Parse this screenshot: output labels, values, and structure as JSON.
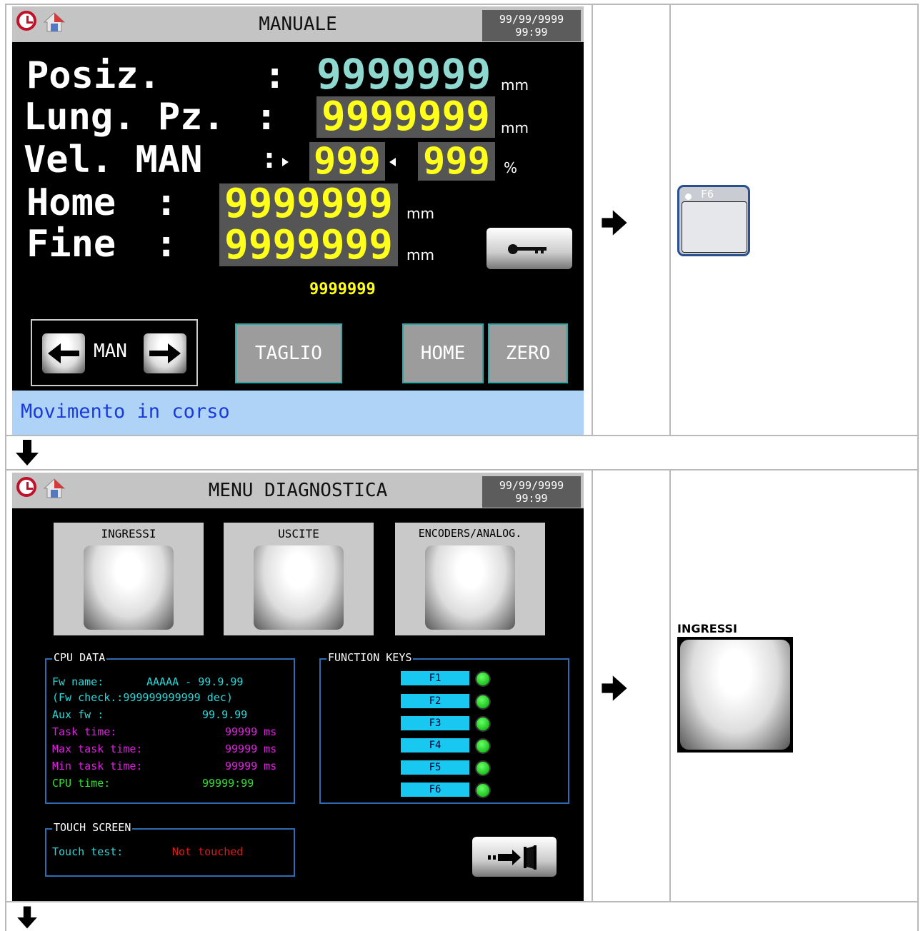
{
  "row1": {
    "screen": {
      "title": "MANUALE",
      "date": "99/99/9999",
      "time": "99:99",
      "fields": {
        "pos_label": "Posiz.",
        "pos_colon": ":",
        "pos_value": "9999999",
        "pos_unit": "mm",
        "len_label": "Lung. Pz.",
        "len_colon": ":",
        "len_value": "9999999",
        "len_unit": "mm",
        "vel_label": "Vel. MAN",
        "vel_colon": ":",
        "vel_fwd": "999",
        "vel_back": "999",
        "vel_unit": "%",
        "home_label": "Home",
        "home_colon": ":",
        "home_value": "9999999",
        "home_unit": "mm",
        "fine_label": "Fine",
        "fine_colon": ":",
        "fine_value": "9999999",
        "fine_unit": "mm",
        "counter": "9999999"
      },
      "buttons": {
        "man": "MAN",
        "taglio": "TAGLIO",
        "home": "HOME",
        "zero": "ZERO"
      },
      "status": "Movimento in corso",
      "colors": {
        "status_bg": "#aed3f7",
        "status_text": "#1a3bd9",
        "value_yellow": "#ffff1a",
        "value_cyan": "#8ed8d0"
      }
    },
    "key": {
      "label": "F6"
    }
  },
  "row2": {
    "screen": {
      "title": "MENU DIAGNOSTICA",
      "date": "99/99/9999",
      "time": "99:99",
      "menu": [
        {
          "label": "INGRESSI"
        },
        {
          "label": "USCITE"
        },
        {
          "label": "ENCODERS/ANALOG."
        }
      ],
      "cpu": {
        "title": "CPU DATA",
        "fw_name_label": "Fw name:",
        "fw_name_value": "AAAAA - 99.9.99",
        "fw_check": "(Fw check.:999999999999 dec)",
        "aux_fw_label": "Aux fw :",
        "aux_fw_value": "99.9.99",
        "task_time_label": "Task time:",
        "task_time_value": "99999 ms",
        "max_task_label": "Max task time:",
        "max_task_value": "99999 ms",
        "min_task_label": "Min task time:",
        "min_task_value": "99999 ms",
        "cpu_time_label": "CPU time:",
        "cpu_time_value": "99999:99"
      },
      "fkeys": {
        "title": "FUNCTION KEYS",
        "keys": [
          "F1",
          "F2",
          "F3",
          "F4",
          "F5",
          "F6"
        ]
      },
      "touch": {
        "title": "TOUCH SCREEN",
        "label": "Touch test:",
        "value": "Not touched"
      }
    },
    "result_label": "INGRESSI"
  }
}
